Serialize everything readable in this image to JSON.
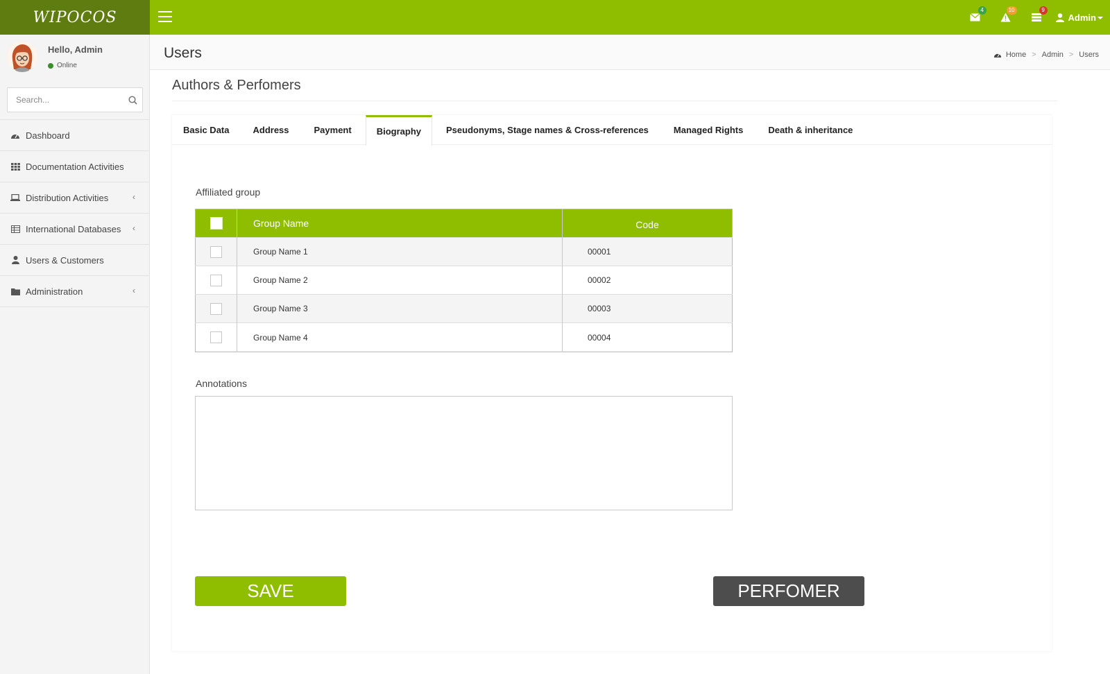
{
  "app": {
    "logo": "WIPOCOS"
  },
  "topbar": {
    "notifications": [
      {
        "icon": "envelope-icon",
        "count": "4",
        "color": "#3aa34a"
      },
      {
        "icon": "warning-icon",
        "count": "10",
        "color": "#f0a030"
      },
      {
        "icon": "tasks-icon",
        "count": "9",
        "color": "#d9352a"
      }
    ],
    "user_label": "Admin"
  },
  "sidebar": {
    "greeting": "Hello, Admin",
    "status": "Online",
    "search_placeholder": "Search...",
    "items": [
      {
        "label": "Dashboard",
        "icon": "dashboard-icon",
        "has_children": false
      },
      {
        "label": "Documentation Activities",
        "icon": "grid-icon",
        "has_children": false
      },
      {
        "label": "Distribution Activities",
        "icon": "laptop-icon",
        "has_children": true
      },
      {
        "label": "International Databases",
        "icon": "table-icon",
        "has_children": true
      },
      {
        "label": "Users & Customers",
        "icon": "user-icon",
        "has_children": false
      },
      {
        "label": "Administration",
        "icon": "folder-icon",
        "has_children": true
      }
    ]
  },
  "header": {
    "title": "Users",
    "breadcrumb": [
      "Home",
      "Admin",
      "Users"
    ]
  },
  "section": {
    "title": "Authors & Perfomers"
  },
  "tabs": [
    {
      "label": "Basic Data",
      "active": false
    },
    {
      "label": "Address",
      "active": false
    },
    {
      "label": "Payment",
      "active": false
    },
    {
      "label": "Biography",
      "active": true
    },
    {
      "label": "Pseudonyms, Stage names & Cross-references",
      "active": false
    },
    {
      "label": "Managed Rights",
      "active": false
    },
    {
      "label": "Death & inheritance",
      "active": false
    }
  ],
  "affiliated": {
    "label": "Affiliated group",
    "columns": {
      "name": "Group Name",
      "code": "Code"
    },
    "rows": [
      {
        "name": "Group Name 1",
        "code": "00001"
      },
      {
        "name": "Group Name 2",
        "code": "00002"
      },
      {
        "name": "Group Name 3",
        "code": "00003"
      },
      {
        "name": "Group Name 4",
        "code": "00004"
      }
    ]
  },
  "annotations": {
    "label": "Annotations",
    "value": ""
  },
  "buttons": {
    "save": "SAVE",
    "performer": "PERFOMER"
  },
  "colors": {
    "accent": "#8fbe00",
    "logo_bg": "#5e7c10",
    "secondary_button": "#4d4d4d"
  }
}
